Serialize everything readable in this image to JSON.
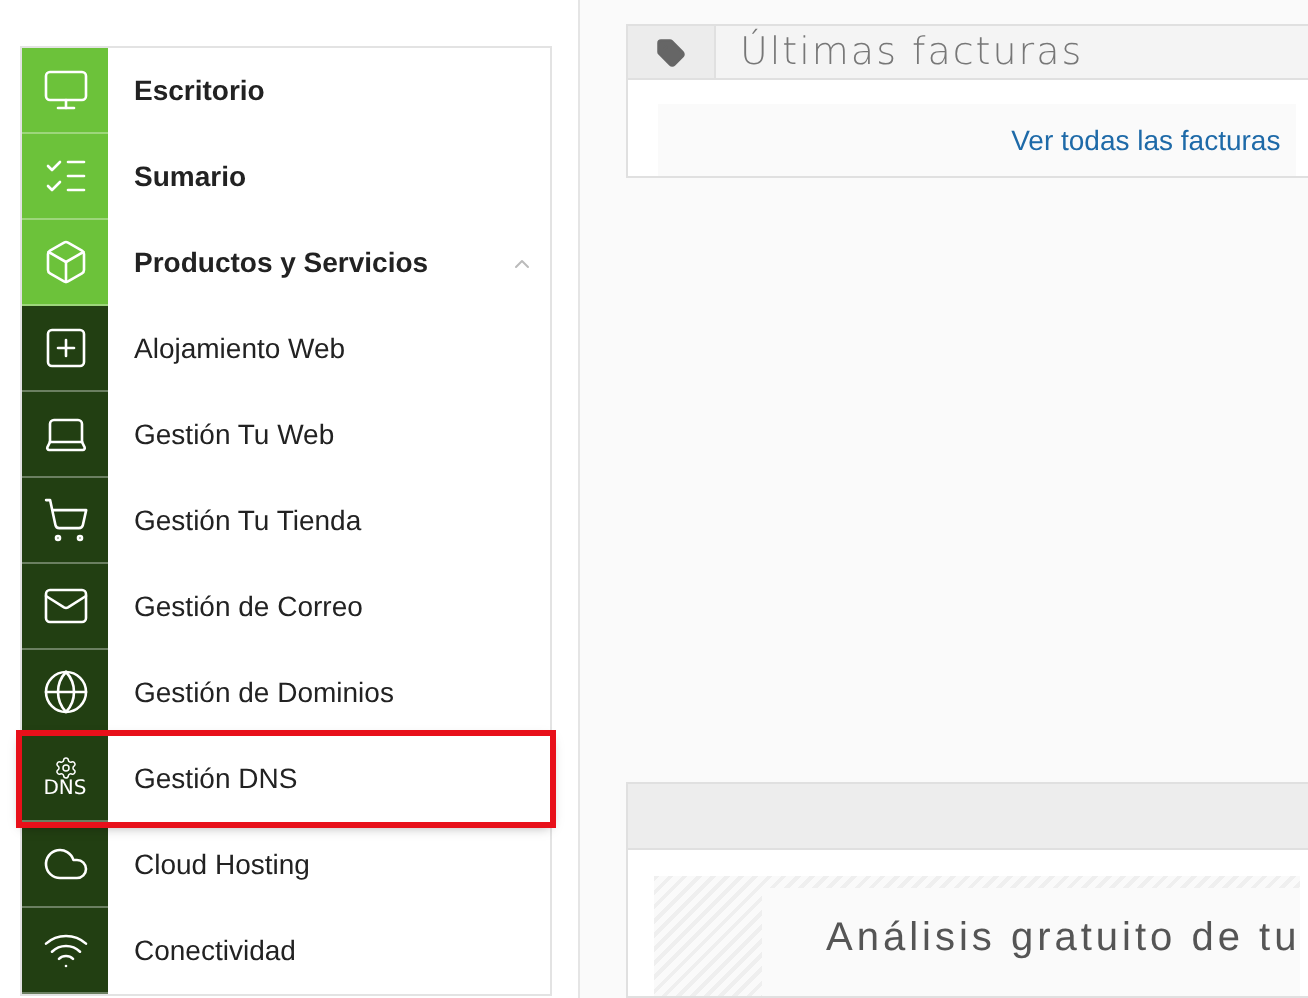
{
  "sidebar": {
    "items": [
      {
        "label": "Escritorio",
        "kind": "section",
        "highlighted": false
      },
      {
        "label": "Sumario",
        "kind": "section",
        "highlighted": false
      },
      {
        "label": "Productos y Servicios",
        "kind": "section",
        "expanded": true,
        "highlighted": false
      },
      {
        "label": "Alojamiento Web",
        "kind": "sub",
        "highlighted": false
      },
      {
        "label": "Gestión Tu Web",
        "kind": "sub",
        "highlighted": false
      },
      {
        "label": "Gestión Tu Tienda",
        "kind": "sub",
        "highlighted": false
      },
      {
        "label": "Gestión de Correo",
        "kind": "sub",
        "highlighted": false
      },
      {
        "label": "Gestión de Dominios",
        "kind": "sub",
        "highlighted": false
      },
      {
        "label": "Gestión DNS",
        "kind": "sub",
        "icon_text": "DNS",
        "highlighted": true
      },
      {
        "label": "Cloud Hosting",
        "kind": "sub",
        "highlighted": false
      },
      {
        "label": "Conectividad",
        "kind": "sub",
        "highlighted": false
      }
    ]
  },
  "invoices_card": {
    "title": "Últimas facturas",
    "link": "Ver todas las facturas"
  },
  "analysis_card": {
    "title": "Análisis gratuito de tu"
  }
}
